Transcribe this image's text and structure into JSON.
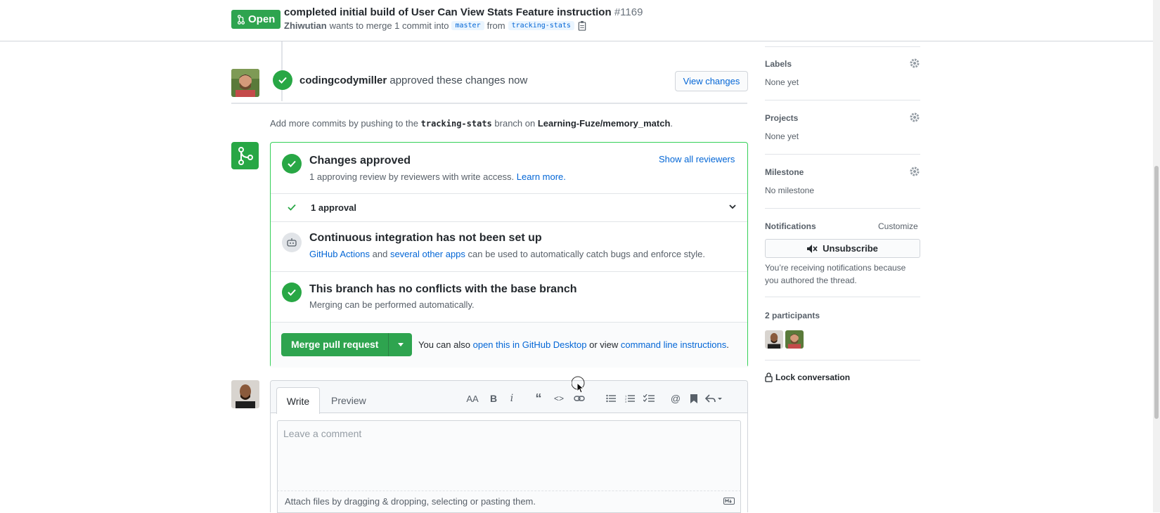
{
  "header": {
    "state": "Open",
    "title": "completed initial build of User Can View Stats Feature instruction",
    "number": "#1169",
    "author": "Zhiwutian",
    "meta_mid": "wants to merge 1 commit into",
    "base_branch": "master",
    "from_text": "from",
    "head_branch": "tracking-stats"
  },
  "review": {
    "reviewer": "codingcodymiller",
    "action": "approved these changes now",
    "view_changes": "View changes"
  },
  "add_commits": {
    "prefix": "Add more commits by pushing to the",
    "branch": "tracking-stats",
    "mid": "branch on",
    "repo": "Learning-Fuze/memory_match",
    "suffix": "."
  },
  "merge": {
    "approved_title": "Changes approved",
    "approved_sub": "1 approving review by reviewers with write access.",
    "learn_more": "Learn more.",
    "show_reviewers": "Show all reviewers",
    "approval_count": "1 approval",
    "ci_title": "Continuous integration has not been set up",
    "ci_link1": "GitHub Actions",
    "ci_and": "and",
    "ci_link2": "several other apps",
    "ci_rest": "can be used to automatically catch bugs and enforce style.",
    "conflict_title": "This branch has no conflicts with the base branch",
    "conflict_sub": "Merging can be performed automatically.",
    "merge_button": "Merge pull request",
    "also": "You can also",
    "desktop_link": "open this in GitHub Desktop",
    "or_view": "or view",
    "cli_link": "command line instructions",
    "period": "."
  },
  "comment": {
    "tab_write": "Write",
    "tab_preview": "Preview",
    "placeholder": "Leave a comment",
    "attach": "Attach files by dragging & dropping, selecting or pasting them.",
    "toolbar": [
      "text-size-icon",
      "bold-icon",
      "italic-icon",
      "quote-icon",
      "code-icon",
      "link-icon",
      "bulleted-list-icon",
      "numbered-list-icon",
      "task-list-icon",
      "mention-icon",
      "bookmark-icon",
      "reply-icon"
    ]
  },
  "sidebar": {
    "labels_h": "Labels",
    "labels_v": "None yet",
    "projects_h": "Projects",
    "projects_v": "None yet",
    "milestone_h": "Milestone",
    "milestone_v": "No milestone",
    "notifications_h": "Notifications",
    "customize": "Customize",
    "unsubscribe": "Unsubscribe",
    "notif_reason_1": "You’re receiving notifications because",
    "notif_reason_2": "you authored the thread.",
    "participants": "2 participants",
    "lock": "Lock conversation"
  },
  "colors": {
    "green": "#28a745",
    "link": "#0366d6",
    "border": "#d1d5da"
  }
}
